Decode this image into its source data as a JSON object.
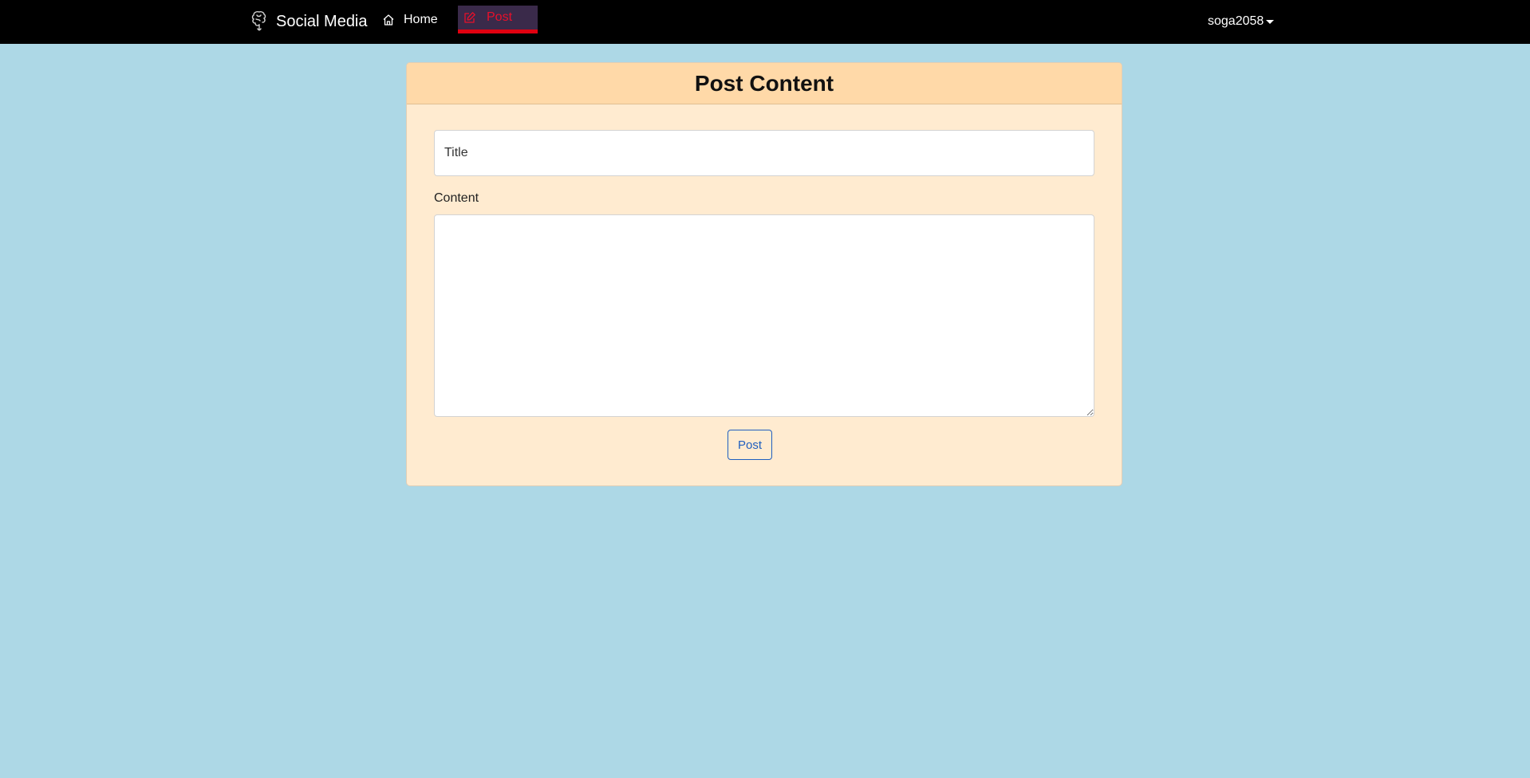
{
  "navbar": {
    "brand": {
      "icon": "brain-icon",
      "label": "Social Media"
    },
    "home": {
      "icon": "home-icon",
      "label": "Home"
    },
    "post": {
      "icon": "edit-icon",
      "label": "Post",
      "active": true
    },
    "user": {
      "label": "soga2058",
      "icon": "caret-down-icon"
    }
  },
  "form": {
    "title": "Post Content",
    "title_field": {
      "placeholder": "Title",
      "value": ""
    },
    "content_label": "Content",
    "content_field": {
      "value": ""
    },
    "submit_label": "Post"
  },
  "colors": {
    "page_background": "#add8e6",
    "navbar_background": "#000000",
    "active_tab_background": "#3a2a4a",
    "active_tab_accent": "#e00010",
    "card_background": "#ffebd0",
    "card_header_background": "#ffd9a8",
    "button_outline": "#1f5fbf"
  }
}
